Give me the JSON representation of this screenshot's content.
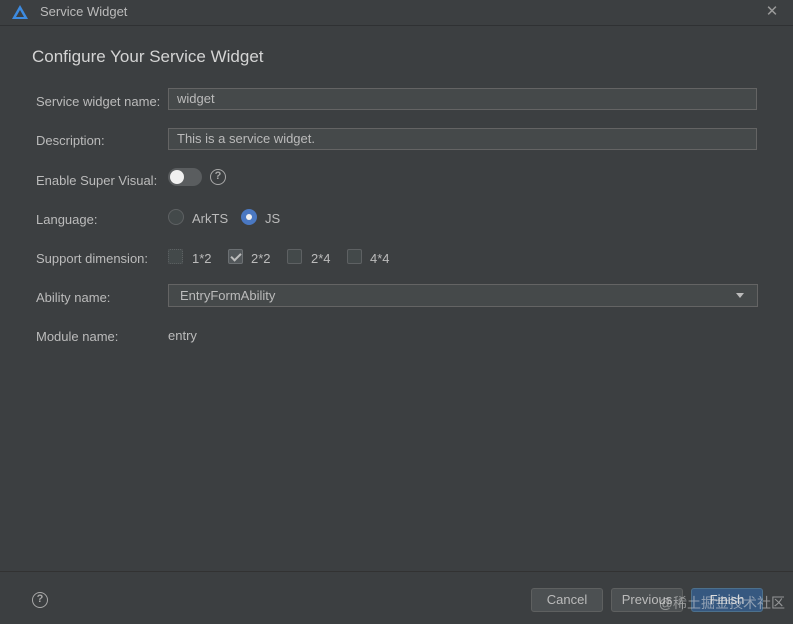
{
  "window": {
    "title": "Service Widget",
    "close_glyph": "✕"
  },
  "heading": "Configure Your Service Widget",
  "form": {
    "widget_name": {
      "label": "Service widget name:",
      "value": "widget"
    },
    "description": {
      "label": "Description:",
      "value": "This is a service widget."
    },
    "super_visual": {
      "label": "Enable Super Visual:",
      "enabled": false,
      "help_glyph": "?"
    },
    "language": {
      "label": "Language:",
      "options": [
        "ArkTS",
        "JS"
      ],
      "selected": "JS"
    },
    "dimension": {
      "label": "Support dimension:",
      "options": [
        {
          "label": "1*2",
          "checked": false
        },
        {
          "label": "2*2",
          "checked": true
        },
        {
          "label": "2*4",
          "checked": false
        },
        {
          "label": "4*4",
          "checked": false
        }
      ]
    },
    "ability": {
      "label": "Ability name:",
      "value": "EntryFormAbility"
    },
    "module": {
      "label": "Module name:",
      "value": "entry"
    }
  },
  "footer": {
    "help_glyph": "?",
    "cancel_label": "Cancel",
    "previous_label": "Previous",
    "finish_label": "Finish"
  },
  "watermark": "@稀土掘金技术社区",
  "colors": {
    "accent": "#4a78c2",
    "primary_button": "#365880",
    "background": "#3c3f41"
  }
}
